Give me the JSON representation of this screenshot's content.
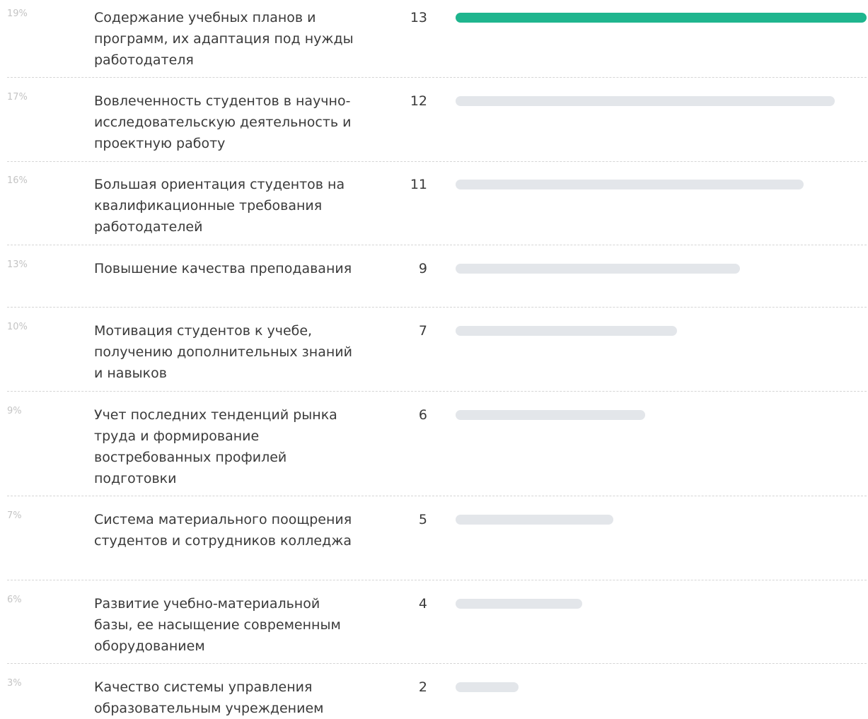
{
  "chart_data": {
    "type": "bar",
    "orientation": "horizontal",
    "categories": [
      "Содержание учебных планов и программ, их адаптация под нужды работодателя",
      "Вовлеченность студентов в научно-исследовательскую деятельность и проектную работу",
      "Большая ориентация студентов на квалификационные требования работодателей",
      "Повышение качества преподавания",
      "Мотивация студентов к учебе, получению дополнительных знаний и навыков",
      "Учет последних тенденций рынка труда и формирование востребованных профилей подготовки",
      "Система материального поощрения студентов и сотрудников колледжа",
      "Развитие учебно-материальной базы, ее насыщение современным оборудованием",
      "Качество системы управления образовательным учреждением"
    ],
    "values": [
      13,
      12,
      11,
      9,
      7,
      6,
      5,
      4,
      2
    ],
    "percent_labels": [
      "19%",
      "17%",
      "16%",
      "13%",
      "10%",
      "9%",
      "7%",
      "6%",
      "3%"
    ],
    "xlim": [
      0,
      13
    ],
    "grid": false,
    "colors": {
      "highlight": "#1fb58e",
      "bar": "#e3e6ea"
    }
  }
}
